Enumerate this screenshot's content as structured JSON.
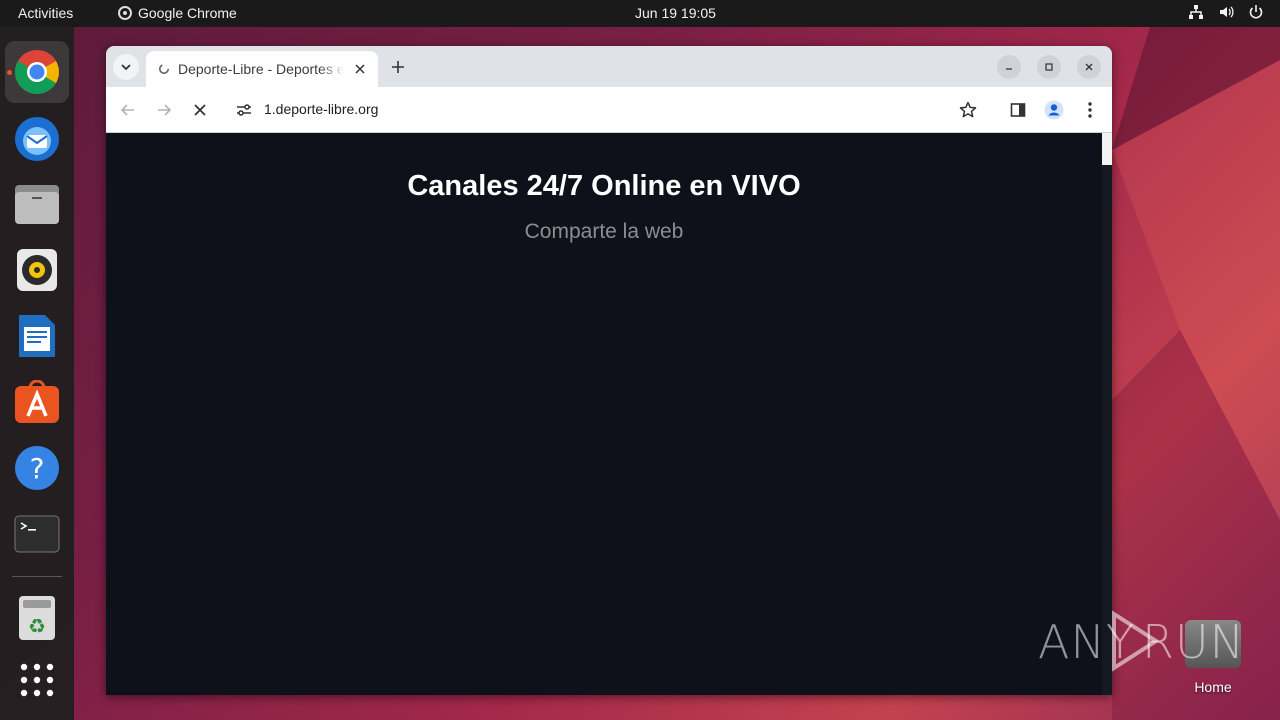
{
  "topbar": {
    "activities": "Activities",
    "app_name": "Google Chrome",
    "datetime": "Jun 19  19:05"
  },
  "dock": {
    "items": [
      "chrome-icon",
      "thunderbird-icon",
      "files-icon",
      "rhythmbox-icon",
      "writer-icon",
      "app-center-icon",
      "help-icon",
      "terminal-icon",
      "trash-icon",
      "app-grid-icon"
    ]
  },
  "browser": {
    "tab": {
      "title": "Deporte-Libre - Deportes en Vivo"
    },
    "address": {
      "url": "1.deporte-libre.org"
    }
  },
  "page": {
    "title": "Canales 24/7 Online en VIVO",
    "subtitle": "Comparte la web"
  },
  "desktop": {
    "watermark": "ANY RUN",
    "home_label": "Home"
  },
  "colors": {
    "accent": "#e95420",
    "page_bg": "#0e111a",
    "tabstrip": "#dfe3e7"
  }
}
